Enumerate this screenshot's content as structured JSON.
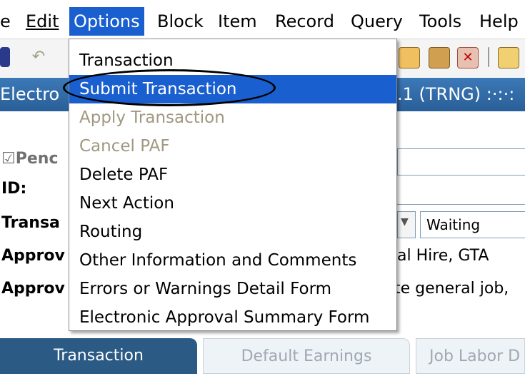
{
  "menubar": {
    "items": [
      "e",
      "Edit",
      "Options",
      "Block",
      "Item",
      "Record",
      "Query",
      "Tools",
      "Help"
    ],
    "active_index": 2
  },
  "titlebar": {
    "left_text": "Electro",
    "right_text": ".1  (TRNG)  :·:·:"
  },
  "form": {
    "pending_label": "Penc",
    "id_label": "ID:",
    "transaction_label": "Transa",
    "status_value": "Waiting",
    "approval_label_1": "Approv",
    "approval_label_2": "Approv",
    "approval_text_1": "al Hire, GTA",
    "approval_text_2": "te general job,"
  },
  "dropdown": {
    "items": [
      {
        "label": "Transaction",
        "disabled": false
      },
      {
        "label": "Submit Transaction",
        "disabled": false,
        "highlighted": true
      },
      {
        "label": "Apply Transaction",
        "disabled": true
      },
      {
        "label": "Cancel PAF",
        "disabled": true
      },
      {
        "label": "Delete PAF",
        "disabled": false
      },
      {
        "label": "Next Action",
        "disabled": false
      },
      {
        "label": "Routing",
        "disabled": false
      },
      {
        "label": "Other Information and Comments",
        "disabled": false
      },
      {
        "label": "Errors or Warnings Detail Form",
        "disabled": false
      },
      {
        "label": "Electronic Approval Summary Form",
        "disabled": false
      }
    ]
  },
  "tabs": {
    "transaction": "Transaction",
    "default_earnings": "Default Earnings",
    "job_labor": "Job Labor D"
  },
  "colors": {
    "menu_highlight": "#1a5fd0",
    "titlebar": "#2a5f98",
    "active_tab": "#2b5b85",
    "disabled_text": "#a09880"
  }
}
